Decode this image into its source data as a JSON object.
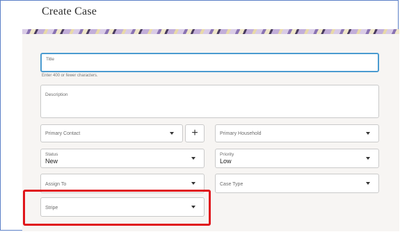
{
  "page": {
    "title": "Create Case"
  },
  "form": {
    "title": {
      "label": "Title",
      "hint": "Enter 400 or fewer characters."
    },
    "description": {
      "label": "Description"
    },
    "primary_contact": {
      "label": "Primary Contact",
      "add_label": "+"
    },
    "primary_household": {
      "label": "Primary Household"
    },
    "status": {
      "label": "Status",
      "value": "New"
    },
    "priority": {
      "label": "Priority",
      "value": "Low"
    },
    "assign_to": {
      "label": "Assign To"
    },
    "case_type": {
      "label": "Case Type"
    },
    "stripe": {
      "label": "Stripe"
    }
  },
  "colors": {
    "accent_focus": "#4a9bd0",
    "highlight_box": "#e0151b",
    "panel_bg": "#f7f5f3"
  },
  "icons": {
    "dropdown": "caret-down-icon",
    "add": "plus-icon"
  }
}
